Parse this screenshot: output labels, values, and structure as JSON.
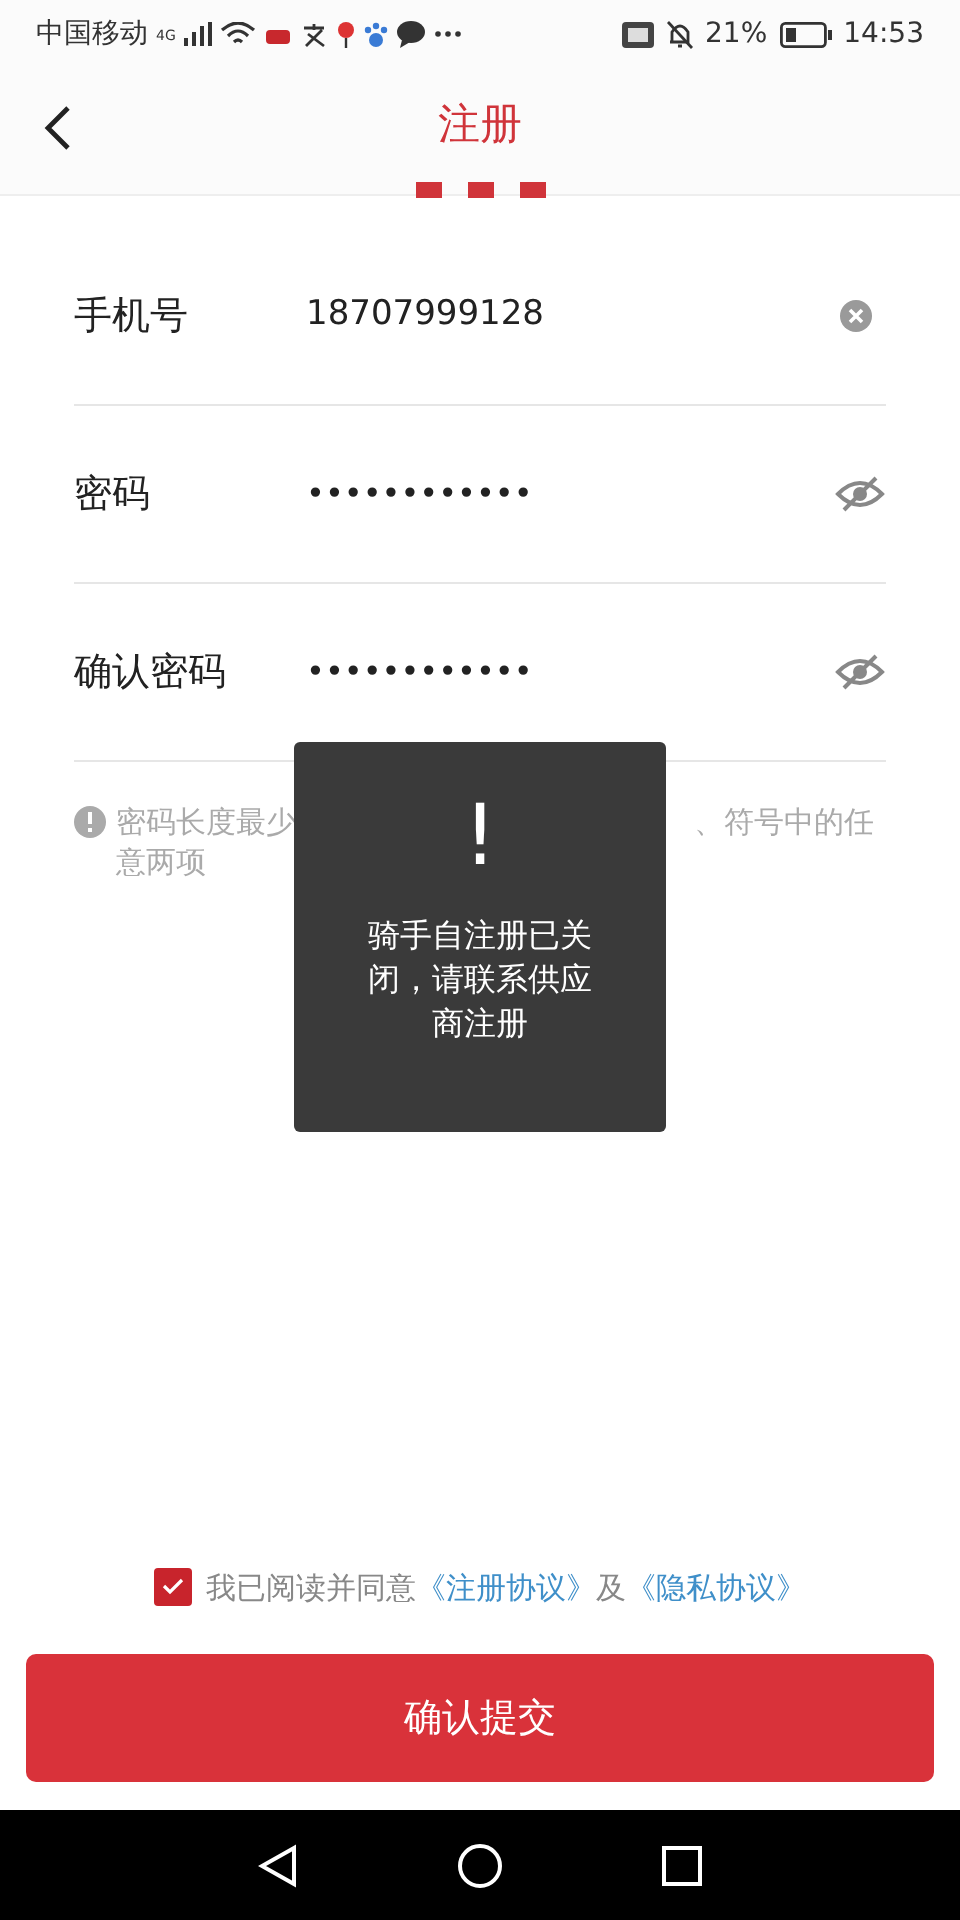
{
  "status_bar": {
    "carrier": "中国移动",
    "network": "4G",
    "battery": "21%",
    "time": "14:53"
  },
  "header": {
    "title": "注册",
    "steps": [
      {
        "selected": true
      },
      {
        "selected": true
      },
      {
        "selected": true
      }
    ]
  },
  "fields": [
    {
      "kind": "clear",
      "label": "手机号",
      "value": "18707999128"
    },
    {
      "kind": "password",
      "label": "密码",
      "value": "••••••••••••"
    },
    {
      "kind": "password",
      "label": "确认密码",
      "value": "••••••••••••"
    }
  ],
  "hint": {
    "visible_parts": [
      "密码长度最少",
      "、符号中的任",
      "意两项"
    ]
  },
  "toast": {
    "icon": "!",
    "message": "骑手自注册已关闭，请联系供应商注册"
  },
  "agreement": {
    "checked": true,
    "text": "我已阅读并同意",
    "link1": "《注册协议》",
    "joiner": "及",
    "link2": "《隐私协议》"
  },
  "submit": "确认提交"
}
